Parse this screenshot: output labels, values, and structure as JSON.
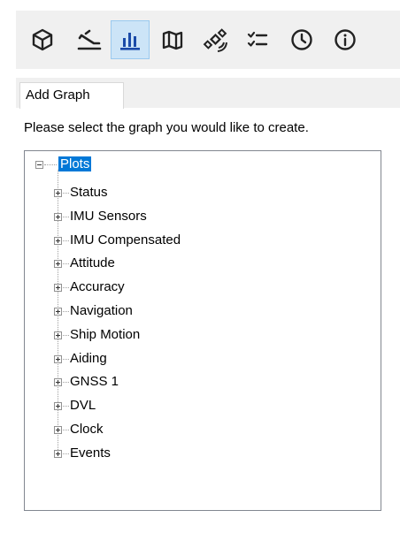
{
  "toolbar": {
    "buttons": [
      {
        "name": "cube-icon",
        "active": false
      },
      {
        "name": "ship-icon",
        "active": false
      },
      {
        "name": "bar-chart-icon",
        "active": true
      },
      {
        "name": "map-icon",
        "active": false
      },
      {
        "name": "satellite-icon",
        "active": false
      },
      {
        "name": "checklist-icon",
        "active": false
      },
      {
        "name": "clock-icon",
        "active": false
      },
      {
        "name": "info-icon",
        "active": false
      }
    ]
  },
  "tab": {
    "label": "Add Graph"
  },
  "instruction": "Please select the graph you would like to create.",
  "tree": {
    "root": "Plots",
    "items": [
      "Status",
      "IMU Sensors",
      "IMU Compensated",
      "Attitude",
      "Accuracy",
      "Navigation",
      "Ship Motion",
      "Aiding",
      "GNSS 1",
      "DVL",
      "Clock",
      "Events"
    ]
  },
  "colors": {
    "accent": "#0078d7",
    "active_button_bg": "#cce4f7",
    "toolbar_bg": "#f0f0f0"
  }
}
